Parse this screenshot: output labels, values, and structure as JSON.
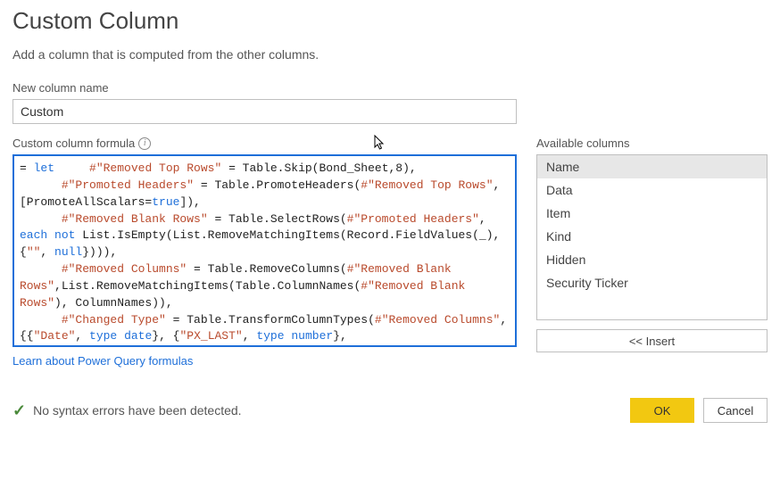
{
  "dialog": {
    "title": "Custom Column",
    "subtitle": "Add a column that is computed from the other columns."
  },
  "new_column": {
    "label": "New column name",
    "value": "Custom"
  },
  "formula": {
    "label": "Custom column formula",
    "tokens": [
      {
        "t": "= ",
        "c": ""
      },
      {
        "t": "let",
        "c": "kw"
      },
      {
        "t": "     ",
        "c": ""
      },
      {
        "t": "#\"Removed Top Rows\"",
        "c": "str"
      },
      {
        "t": " = Table.Skip(Bond_Sheet,8),\n      ",
        "c": ""
      },
      {
        "t": "#\"Promoted Headers\"",
        "c": "str"
      },
      {
        "t": " = Table.PromoteHeaders(",
        "c": ""
      },
      {
        "t": "#\"Removed Top Rows\"",
        "c": "str"
      },
      {
        "t": ", [PromoteAllScalars=",
        "c": ""
      },
      {
        "t": "true",
        "c": "bool"
      },
      {
        "t": "]),\n      ",
        "c": ""
      },
      {
        "t": "#\"Removed Blank Rows\"",
        "c": "str"
      },
      {
        "t": " = Table.SelectRows(",
        "c": ""
      },
      {
        "t": "#\"Promoted Headers\"",
        "c": "str"
      },
      {
        "t": ", ",
        "c": ""
      },
      {
        "t": "each",
        "c": "kw"
      },
      {
        "t": " ",
        "c": ""
      },
      {
        "t": "not",
        "c": "kw"
      },
      {
        "t": " List.IsEmpty(List.RemoveMatchingItems(Record.FieldValues(_), {",
        "c": ""
      },
      {
        "t": "\"\"",
        "c": "str"
      },
      {
        "t": ", ",
        "c": ""
      },
      {
        "t": "null",
        "c": "null"
      },
      {
        "t": "}))),\n      ",
        "c": ""
      },
      {
        "t": "#\"Removed Columns\"",
        "c": "str"
      },
      {
        "t": " = Table.RemoveColumns(",
        "c": ""
      },
      {
        "t": "#\"Removed Blank Rows\"",
        "c": "str"
      },
      {
        "t": ",List.RemoveMatchingItems(Table.ColumnNames(",
        "c": ""
      },
      {
        "t": "#\"Removed Blank Rows\"",
        "c": "str"
      },
      {
        "t": "), ColumnNames)),\n      ",
        "c": ""
      },
      {
        "t": "#\"Changed Type\"",
        "c": "str"
      },
      {
        "t": " = Table.TransformColumnTypes(",
        "c": ""
      },
      {
        "t": "#\"Removed Columns\"",
        "c": "str"
      },
      {
        "t": ",{{",
        "c": ""
      },
      {
        "t": "\"Date\"",
        "c": "str"
      },
      {
        "t": ", ",
        "c": ""
      },
      {
        "t": "type",
        "c": "kw"
      },
      {
        "t": " ",
        "c": ""
      },
      {
        "t": "date",
        "c": "type"
      },
      {
        "t": "}, {",
        "c": ""
      },
      {
        "t": "\"PX_LAST\"",
        "c": "str"
      },
      {
        "t": ", ",
        "c": ""
      },
      {
        "t": "type",
        "c": "kw"
      },
      {
        "t": " ",
        "c": ""
      },
      {
        "t": "number",
        "c": "type"
      },
      {
        "t": "},",
        "c": ""
      }
    ]
  },
  "learn_link": "Learn about Power Query formulas",
  "available": {
    "label": "Available columns",
    "items": [
      "Name",
      "Data",
      "Item",
      "Kind",
      "Hidden",
      "Security Ticker"
    ],
    "selected_index": 0,
    "insert_label": "<< Insert"
  },
  "status": {
    "message": "No syntax errors have been detected."
  },
  "buttons": {
    "ok": "OK",
    "cancel": "Cancel"
  }
}
